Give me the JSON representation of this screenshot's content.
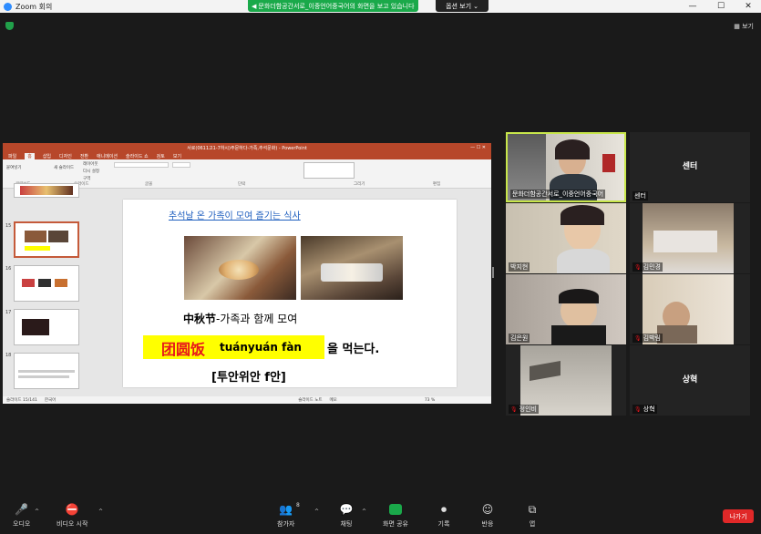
{
  "window": {
    "title": "Zoom 회의"
  },
  "banner": {
    "text": "문화더함공간서로_이중언어중국어의 화면을 보고 있습니다",
    "options_label": "옵션 보기"
  },
  "view_label": "보기",
  "powerpoint": {
    "title": "서로(0611고1-7하시)주문하다-가족,추석문화) - PowerPoint",
    "tabs": [
      "파일",
      "홈",
      "삽입",
      "디자인",
      "전환",
      "애니메이션",
      "슬라이드 쇼",
      "검토",
      "보기"
    ],
    "ribbon_groups": [
      "클립보드",
      "슬라이드",
      "글꼴",
      "단락",
      "그리기",
      "편집"
    ],
    "ribbon_items": {
      "paste": "붙여넣기",
      "new_slide": "새 슬라이드",
      "layout": "레이아웃",
      "reset": "다시 설정",
      "section": "구역"
    },
    "thumbnails": [
      {
        "num": "15"
      },
      {
        "num": "16"
      },
      {
        "num": "17"
      },
      {
        "num": "18"
      }
    ],
    "status": {
      "slide": "슬라이드 15/141",
      "lang": "한국어",
      "notes": "슬라이드 노트",
      "comments": "메모",
      "zoom": "73 %"
    }
  },
  "slide": {
    "title": "추석날 온 가족이 모여 즐기는 식사",
    "line1_bold": "中秋节",
    "line1_rest": "-가족과 함께 모여",
    "highlight_cn": "团圆饭",
    "highlight_pinyin": "tuányuán fàn",
    "highlight_rest": "을 먹는다.",
    "line3": "[투안위안 f안]"
  },
  "participants": [
    {
      "name": "문화더함공간서로_이중언어중국어",
      "video": true,
      "active": true,
      "muted": false
    },
    {
      "name": "센터",
      "video": false,
      "center": "센터",
      "muted": false
    },
    {
      "name": "박지현",
      "video": true,
      "muted": false
    },
    {
      "name": "김민경",
      "video": true,
      "muted": true
    },
    {
      "name": "김은원",
      "video": true,
      "muted": false
    },
    {
      "name": "김박림",
      "video": true,
      "muted": true
    },
    {
      "name": "정인비",
      "video": true,
      "muted": true
    },
    {
      "name": "상혁",
      "video": false,
      "center": "상혁",
      "muted": true
    }
  ],
  "toolbar": {
    "audio": "오디오",
    "video": "비디오 시작",
    "participants": "참가자",
    "participants_count": "8",
    "chat": "채팅",
    "share": "화면 공유",
    "record": "기록",
    "reactions": "반응",
    "apps": "앱",
    "leave": "나가기"
  },
  "colors": {
    "share_green": "#1aa94a",
    "active_speaker": "#c8e64b",
    "leave_red": "#e02828",
    "ppt_red": "#b7472a"
  }
}
